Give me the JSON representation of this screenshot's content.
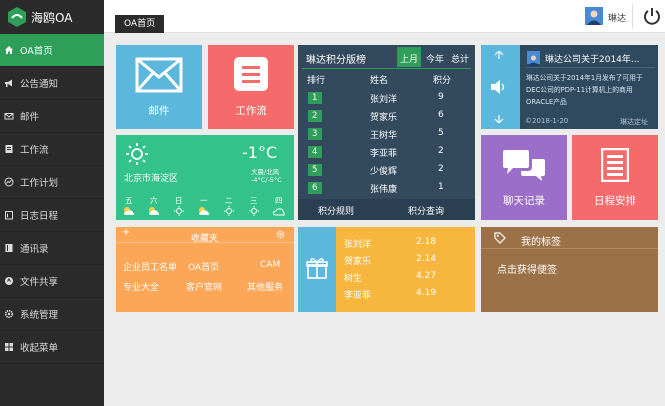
{
  "app": {
    "logo_text": "海鸥OA"
  },
  "sidebar": {
    "items": [
      {
        "label": "OA首页",
        "icon": "home-icon"
      },
      {
        "label": "公告通知",
        "icon": "megaphone-icon"
      },
      {
        "label": "邮件",
        "icon": "mail-icon"
      },
      {
        "label": "工作流",
        "icon": "list-icon"
      },
      {
        "label": "工作计划",
        "icon": "chart-icon"
      },
      {
        "label": "日志日程",
        "icon": "calendar-icon"
      },
      {
        "label": "通讯录",
        "icon": "book-icon"
      },
      {
        "label": "文件共享",
        "icon": "share-icon"
      },
      {
        "label": "系统管理",
        "icon": "gear-icon"
      },
      {
        "label": "收起菜单",
        "icon": "grid-icon"
      }
    ]
  },
  "header": {
    "breadcrumb": "OA首页",
    "user_name": "琳达"
  },
  "tiles": {
    "mail": {
      "label": "邮件"
    },
    "workflow": {
      "label": "工作流"
    },
    "ranking": {
      "title": "琳达积分版榜",
      "tabs": [
        "上月",
        "今年",
        "总计"
      ],
      "headers": {
        "rank": "排行",
        "name": "姓名",
        "score": "积分"
      },
      "rows": [
        {
          "rank": "1",
          "name": "张刘洋",
          "score": "9"
        },
        {
          "rank": "2",
          "name": "贺家乐",
          "score": "6"
        },
        {
          "rank": "3",
          "name": "王树华",
          "score": "5"
        },
        {
          "rank": "4",
          "name": "李亚菲",
          "score": "2"
        },
        {
          "rank": "5",
          "name": "少俊辉",
          "score": "2"
        },
        {
          "rank": "6",
          "name": "张伟康",
          "score": "1"
        }
      ],
      "footer": [
        "积分规则",
        "积分查询"
      ]
    },
    "notice": {
      "title": "琳达公司关于2014年...",
      "body": "琳达公司关于2014年1月发布了可用于DEC公司的PDP-11计算机上的商用ORACLE产品",
      "date": "©2018-1-20",
      "author": "琳达定址"
    },
    "weather": {
      "temp": "-1°C",
      "location": "北京市海淀区",
      "wind": "大晨/北风",
      "range": "-4°C/-5°C",
      "days": [
        "五",
        "六",
        "日",
        "一",
        "二",
        "三",
        "四"
      ]
    },
    "chat": {
      "label": "聊天记录"
    },
    "schedule": {
      "label": "日程安排"
    },
    "favorites": {
      "title": "收藏夹",
      "links": [
        "企业员工名单",
        "OA首页",
        "CAM",
        "专业大全",
        "客户官网",
        "其他服务"
      ]
    },
    "gift": {
      "rows": [
        {
          "name": "张刘洋",
          "value": "2.18"
        },
        {
          "name": "贺家乐",
          "value": "2.14"
        },
        {
          "name": "树生",
          "value": "4.27"
        },
        {
          "name": "李亚菲",
          "value": "4.19"
        }
      ]
    },
    "tags": {
      "title": "我的标签",
      "subtitle": "点击获得便签"
    }
  }
}
